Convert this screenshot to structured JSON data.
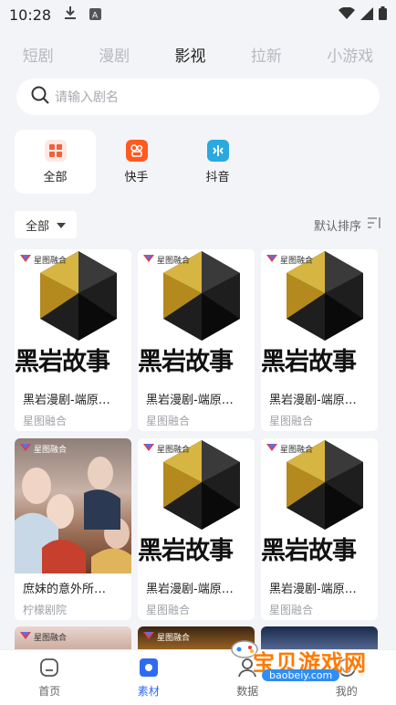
{
  "status": {
    "time": "10:28"
  },
  "tabs": [
    {
      "label": "短剧",
      "active": false
    },
    {
      "label": "漫剧",
      "active": false
    },
    {
      "label": "影视",
      "active": true
    },
    {
      "label": "拉新",
      "active": false
    },
    {
      "label": "小游戏",
      "active": false
    }
  ],
  "search": {
    "placeholder": "请输入剧名"
  },
  "platforms": [
    {
      "label": "全部",
      "icon": "grid-icon",
      "color": "#f0603a",
      "active": true
    },
    {
      "label": "快手",
      "icon": "kuaishou-icon",
      "color": "#ff5a1f",
      "active": false
    },
    {
      "label": "抖音",
      "icon": "douyin-icon",
      "color": "#2aa9e0",
      "active": false
    }
  ],
  "filter": {
    "label": "全部",
    "sort_label": "默认排序"
  },
  "cards": [
    {
      "badge": "星图融合",
      "cover_text": "黑岩故事",
      "title": "黑岩漫剧-端原…",
      "source": "星图融合"
    },
    {
      "badge": "星图融合",
      "cover_text": "黑岩故事",
      "title": "黑岩漫剧-端原…",
      "source": "星图融合"
    },
    {
      "badge": "星图融合",
      "cover_text": "黑岩故事",
      "title": "黑岩漫剧-端原…",
      "source": "星图融合"
    },
    {
      "badge": "星图融合",
      "cover_text": "",
      "title": "庶妹的意外所…",
      "source": "柠檬剧院"
    },
    {
      "badge": "星图融合",
      "cover_text": "黑岩故事",
      "title": "黑岩漫剧-端原…",
      "source": "星图融合"
    },
    {
      "badge": "星图融合",
      "cover_text": "黑岩故事",
      "title": "黑岩漫剧-端原…",
      "source": "星图融合"
    }
  ],
  "peek_badges": [
    "星图融合",
    "星图融合"
  ],
  "nav": [
    {
      "label": "首页",
      "active": false
    },
    {
      "label": "素材",
      "active": true
    },
    {
      "label": "数据",
      "active": false
    },
    {
      "label": "我的",
      "active": false
    }
  ],
  "watermark": {
    "text": "宝贝游戏网",
    "url": "baobeiy.com"
  },
  "colors": {
    "accent": "#2f6bf0",
    "background": "#f3f4f7"
  }
}
